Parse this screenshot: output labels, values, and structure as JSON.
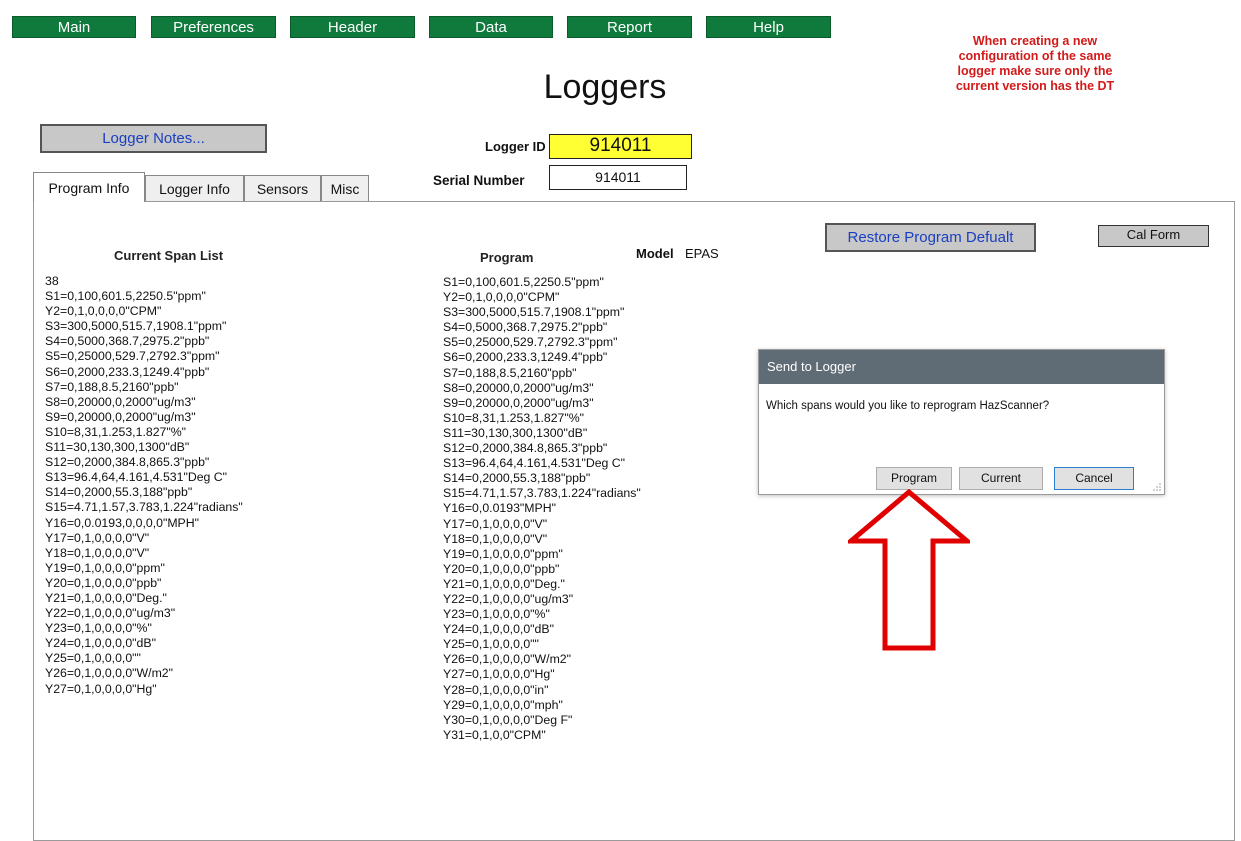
{
  "nav": {
    "items": [
      "Main",
      "Preferences",
      "Header",
      "Data",
      "Report",
      "Help"
    ]
  },
  "warning": {
    "lines": [
      "When creating a new",
      "configuration of the same",
      "logger make sure only the",
      "current version has the DT"
    ],
    "color": "#d31a1a"
  },
  "page": {
    "title": "Loggers",
    "logger_notes_label": "Logger Notes...",
    "logger_id_label": "Logger ID",
    "logger_id_value": "914011",
    "serial_label": "Serial Number",
    "serial_value": "914011",
    "restore_label": "Restore Program Defualt",
    "cal_form_label": "Cal Form",
    "model_label": "Model",
    "model_value": "EPAS"
  },
  "tabs": [
    {
      "label": "Program Info",
      "active": true
    },
    {
      "label": "Logger Info",
      "active": false
    },
    {
      "label": "Sensors",
      "active": false
    },
    {
      "label": "Misc",
      "active": false
    }
  ],
  "current_span": {
    "heading": "Current Span List",
    "lines": [
      "38",
      "S1=0,100,601.5,2250.5\"ppm\"",
      "Y2=0,1,0,0,0,0\"CPM\"",
      "S3=300,5000,515.7,1908.1\"ppm\"",
      "S4=0,5000,368.7,2975.2\"ppb\"",
      "S5=0,25000,529.7,2792.3\"ppm\"",
      "S6=0,2000,233.3,1249.4\"ppb\"",
      "S7=0,188,8.5,2160\"ppb\"",
      "S8=0,20000,0,2000\"ug/m3\"",
      "S9=0,20000,0,2000\"ug/m3\"",
      "S10=8,31,1.253,1.827\"%\"",
      "S11=30,130,300,1300\"dB\"",
      "S12=0,2000,384.8,865.3\"ppb\"",
      "S13=96.4,64,4.161,4.531\"Deg C\"",
      "S14=0,2000,55.3,188\"ppb\"",
      "S15=4.71,1.57,3.783,1.224\"radians\"",
      "Y16=0,0.0193,0,0,0,0\"MPH\"",
      "Y17=0,1,0,0,0,0\"V\"",
      "Y18=0,1,0,0,0,0\"V\"",
      "Y19=0,1,0,0,0,0\"ppm\"",
      "Y20=0,1,0,0,0,0\"ppb\"",
      "Y21=0,1,0,0,0,0\"Deg.\"",
      "Y22=0,1,0,0,0,0\"ug/m3\"",
      "Y23=0,1,0,0,0,0\"%\"",
      "Y24=0,1,0,0,0,0\"dB\"",
      "Y25=0,1,0,0,0,0\"\"",
      "Y26=0,1,0,0,0,0\"W/m2\"",
      "Y27=0,1,0,0,0,0\"Hg\""
    ]
  },
  "program": {
    "heading": "Program",
    "lines": [
      "S1=0,100,601.5,2250.5\"ppm\"",
      "Y2=0,1,0,0,0,0\"CPM\"",
      "S3=300,5000,515.7,1908.1\"ppm\"",
      "S4=0,5000,368.7,2975.2\"ppb\"",
      "S5=0,25000,529.7,2792.3\"ppm\"",
      "S6=0,2000,233.3,1249.4\"ppb\"",
      "S7=0,188,8.5,2160\"ppb\"",
      "S8=0,20000,0,2000\"ug/m3\"",
      "S9=0,20000,0,2000\"ug/m3\"",
      "S10=8,31,1.253,1.827\"%\"",
      "S11=30,130,300,1300\"dB\"",
      "S12=0,2000,384.8,865.3\"ppb\"",
      "S13=96.4,64,4.161,4.531\"Deg C\"",
      "S14=0,2000,55.3,188\"ppb\"",
      "S15=4.71,1.57,3.783,1.224\"radians\"",
      "Y16=0,0.0193\"MPH\"",
      "Y17=0,1,0,0,0,0\"V\"",
      "Y18=0,1,0,0,0,0\"V\"",
      "Y19=0,1,0,0,0,0\"ppm\"",
      "Y20=0,1,0,0,0,0\"ppb\"",
      "Y21=0,1,0,0,0,0\"Deg.\"",
      "Y22=0,1,0,0,0,0\"ug/m3\"",
      "Y23=0,1,0,0,0,0\"%\"",
      "Y24=0,1,0,0,0,0\"dB\"",
      "Y25=0,1,0,0,0,0\"\"",
      "Y26=0,1,0,0,0,0\"W/m2\"",
      "Y27=0,1,0,0,0,0\"Hg\"",
      "Y28=0,1,0,0,0,0\"in\"",
      "Y29=0,1,0,0,0,0\"mph\"",
      "Y30=0,1,0,0,0,0\"Deg F\"",
      "Y31=0,1,0,0\"CPM\""
    ]
  },
  "dialog": {
    "title": "Send to Logger",
    "message": "Which spans would you like to reprogram HazScanner?",
    "buttons": [
      "Program",
      "Current",
      "Cancel"
    ]
  },
  "colors": {
    "nav_green": "#0f7a3c",
    "logger_id_highlight": "#ffff33",
    "link_blue": "#1a3fc0",
    "arrow_red": "#e00000"
  }
}
